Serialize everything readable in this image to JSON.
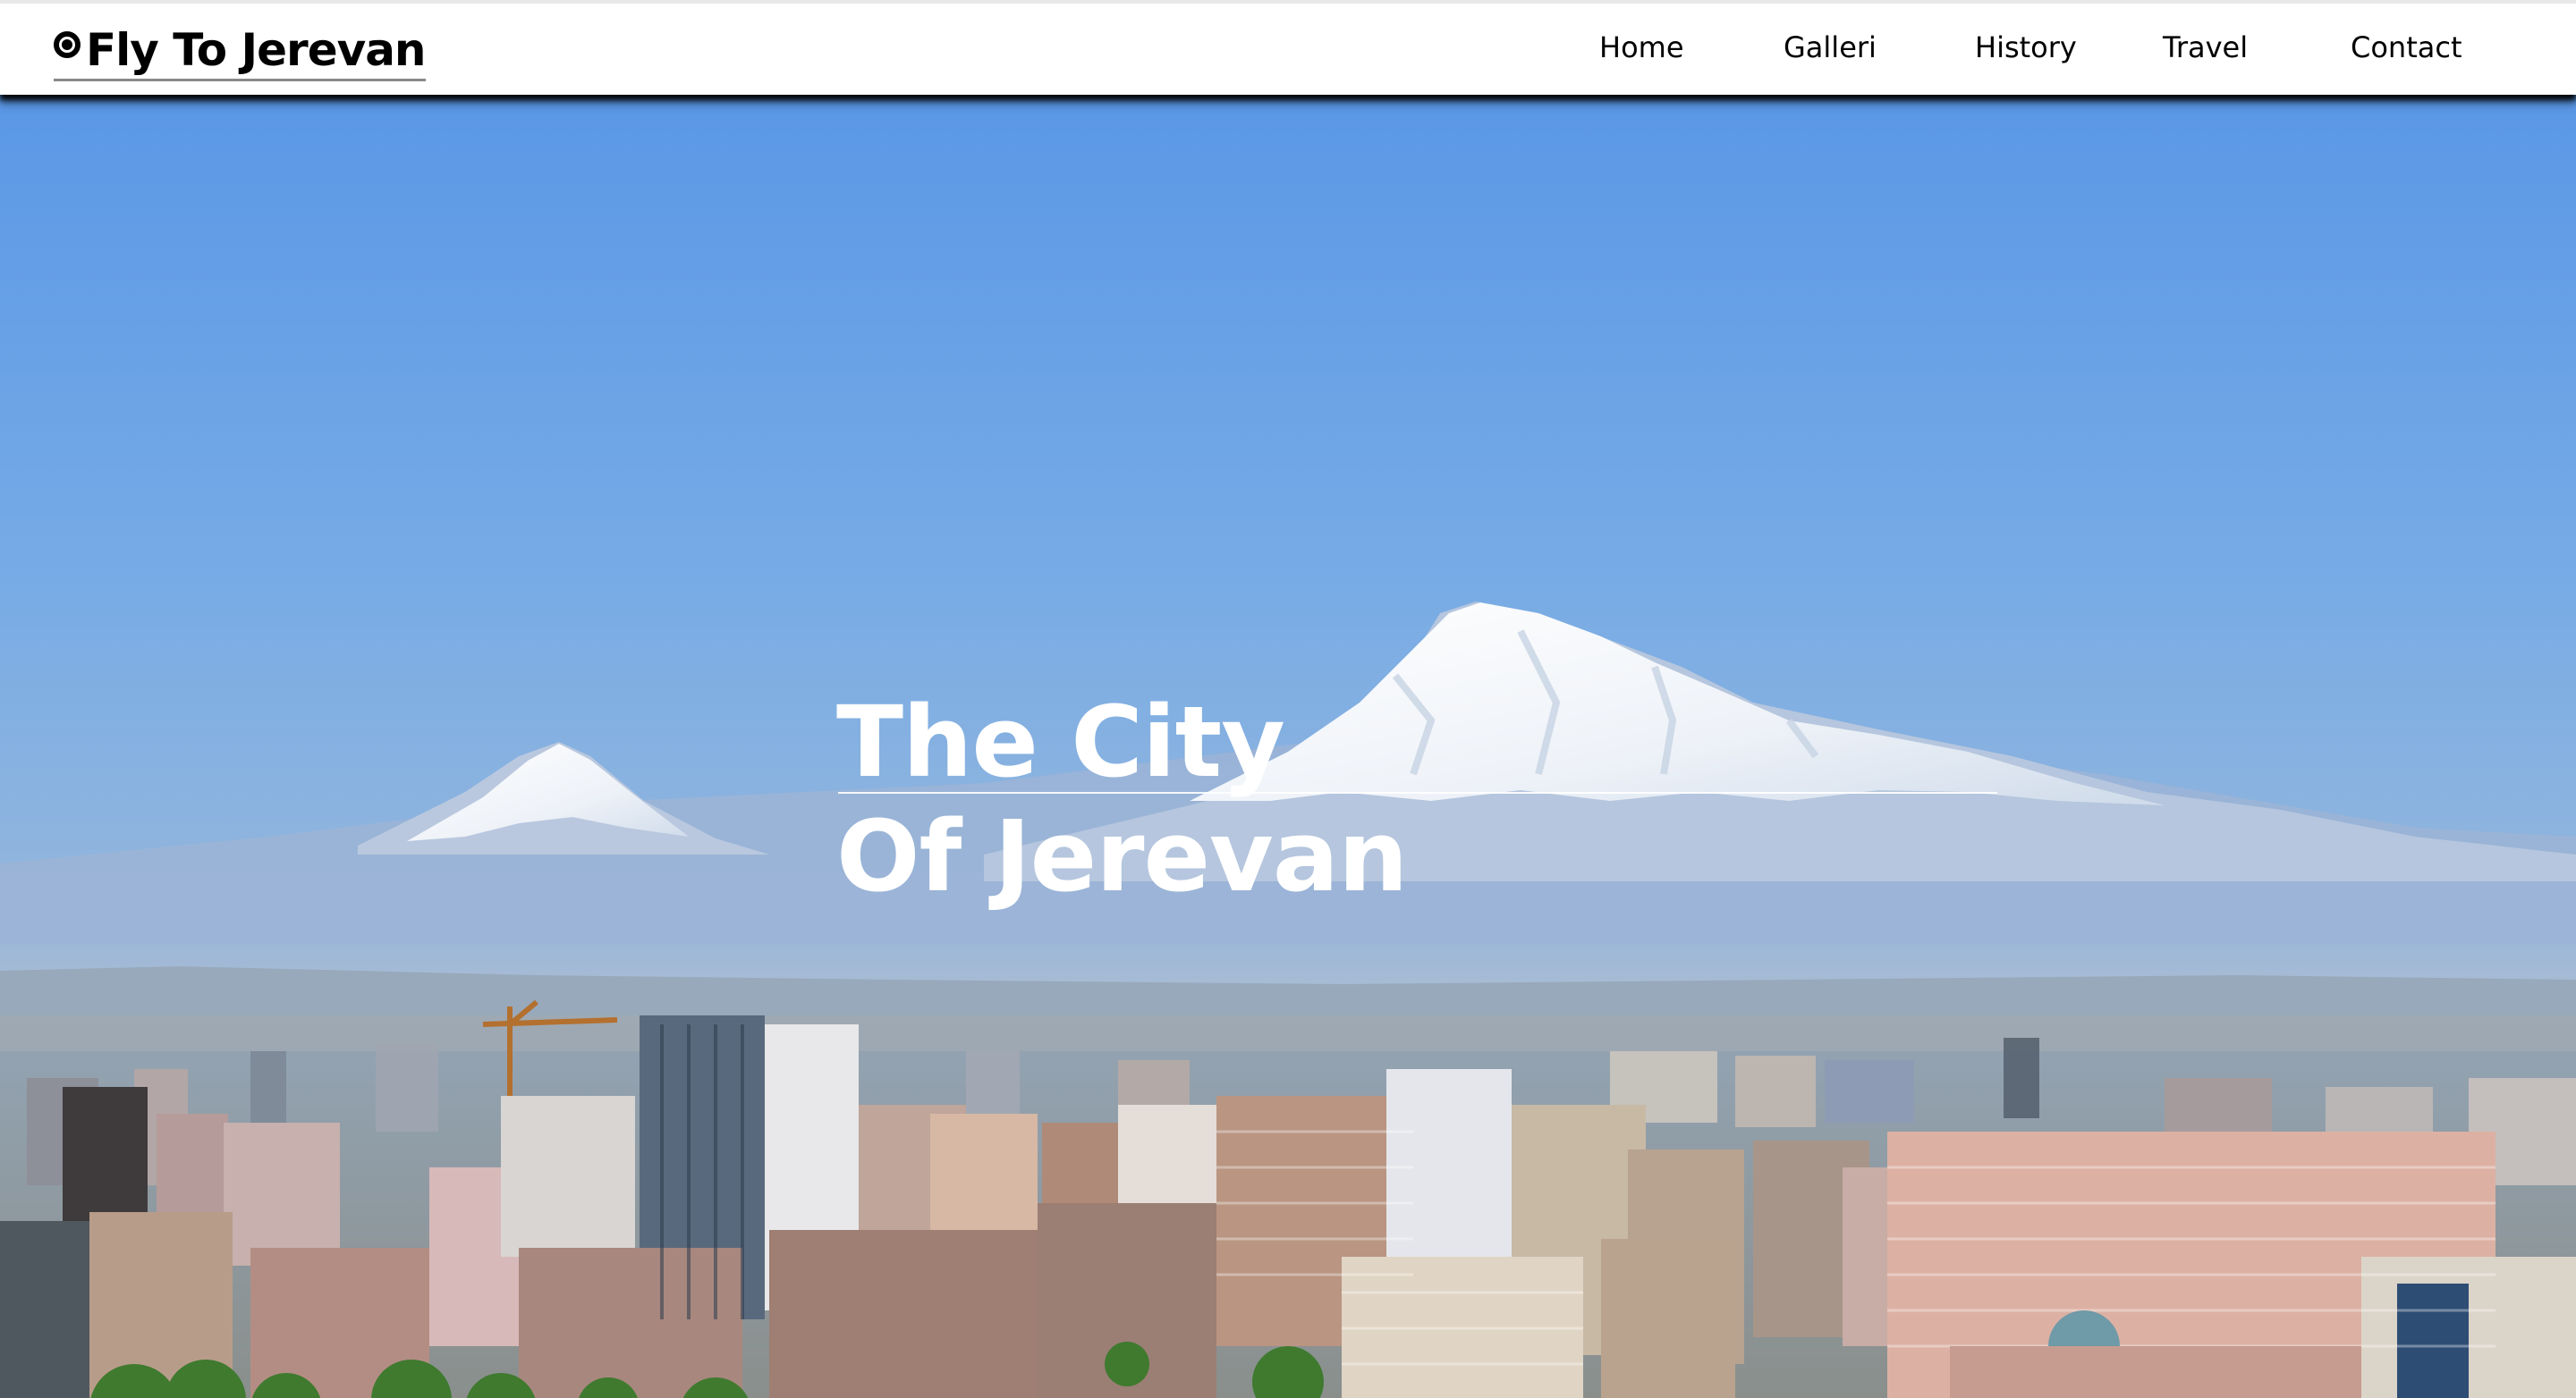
{
  "header": {
    "brand": {
      "icon": "radio-dot-icon",
      "title": "Fly To Jerevan"
    },
    "nav": [
      {
        "label": "Home"
      },
      {
        "label": "Galleri"
      },
      {
        "label": "History"
      },
      {
        "label": "Travel"
      },
      {
        "label": "Contact"
      }
    ]
  },
  "hero": {
    "title_line1": "The City",
    "title_line2": "Of Jerevan",
    "image": "city-skyline-with-snowcapped-mountains"
  },
  "colors": {
    "nav_background": "#ffffff",
    "text": "#000000",
    "hero_text": "#ffffff",
    "sky": "#5c99e6"
  }
}
